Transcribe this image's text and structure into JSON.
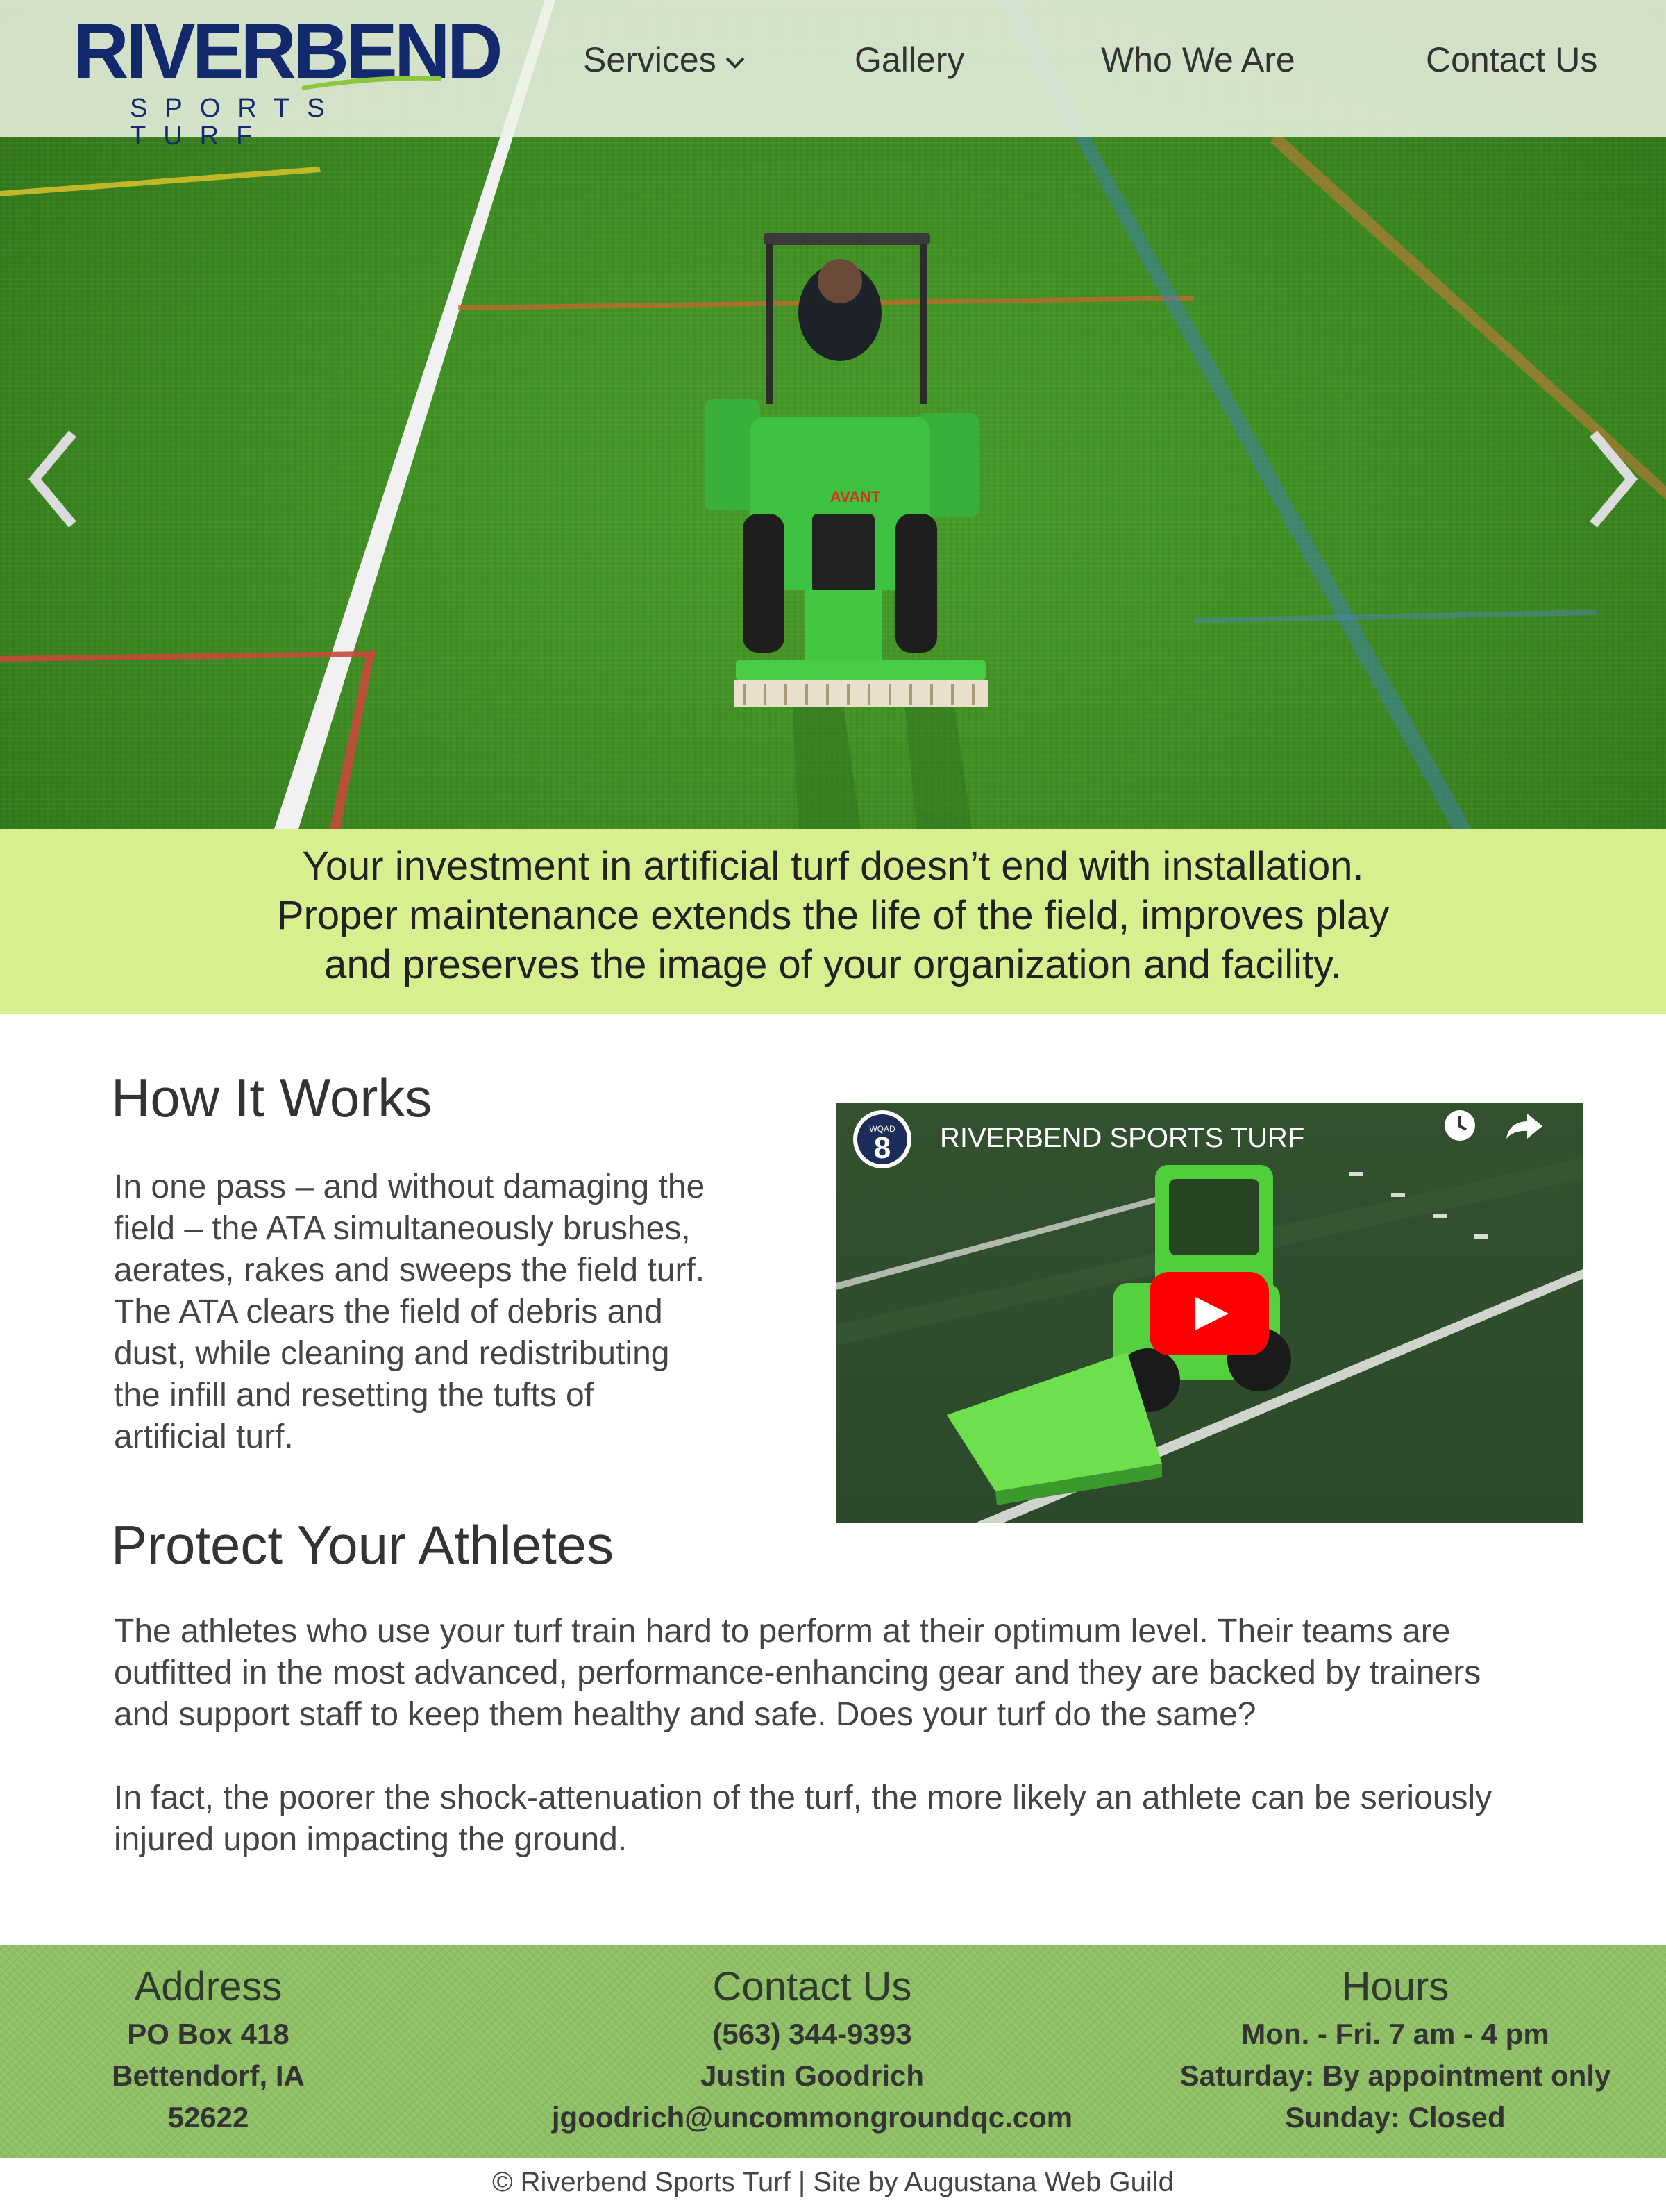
{
  "brand": {
    "name": "RIVERBEND",
    "tagline": "SPORTS TURF",
    "primary_color": "#13296d",
    "accent_color": "#8cc63f"
  },
  "nav": {
    "items": [
      {
        "label": "Services",
        "has_dropdown": true
      },
      {
        "label": "Gallery"
      },
      {
        "label": "Who We Are"
      },
      {
        "label": "Contact Us"
      }
    ]
  },
  "hero": {
    "prev_icon": "chevron-left-icon",
    "next_icon": "chevron-right-icon",
    "machine_brand": "AVANT"
  },
  "intro": {
    "lines": [
      "Your investment in artificial turf doesn’t end with installation.",
      "Proper maintenance extends the life of the field, improves play",
      "and preserves the image of your organization and facility."
    ],
    "background": "#d8ef8f"
  },
  "how_it_works": {
    "heading": "How It Works",
    "lines": [
      "In one pass – and without damaging the",
      "field – the ATA simultaneously brushes,",
      "aerates, rakes and sweeps the field turf.",
      "The ATA clears the field of debris and",
      "dust, while cleaning and redistributing",
      "the infill and resetting the tufts of",
      "artificial turf."
    ]
  },
  "video": {
    "title": "RIVERBEND SPORTS TURF",
    "channel_badge": "8",
    "channel_text": "WQAD",
    "icons": [
      "clock-icon",
      "share-icon",
      "play-icon"
    ]
  },
  "protect": {
    "heading": "Protect Your Athletes",
    "p1_lines": [
      "The athletes who use your turf train hard to perform at their optimum level. Their teams are",
      "outfitted in the most advanced, performance-enhancing gear and they are backed by trainers",
      "and support staff to keep them healthy and safe. Does your turf do the same?"
    ],
    "p2_lines": [
      "In fact, the poorer the shock-attenuation of the turf, the more likely an athlete can be seriously",
      "injured upon impacting the ground."
    ]
  },
  "footer": {
    "address": {
      "heading": "Address",
      "lines": [
        "PO Box 418",
        "Bettendorf, IA",
        "52622"
      ]
    },
    "contact": {
      "heading": "Contact Us",
      "lines": [
        "(563) 344-9393",
        "Justin Goodrich",
        "jgoodrich@uncommongroundqc.com"
      ]
    },
    "hours": {
      "heading": "Hours",
      "lines": [
        "Mon. - Fri. 7 am - 4 pm",
        "Saturday: By appointment only",
        "Sunday: Closed"
      ]
    },
    "copyright": "© Riverbend Sports Turf | Site by Augustana Web Guild"
  }
}
